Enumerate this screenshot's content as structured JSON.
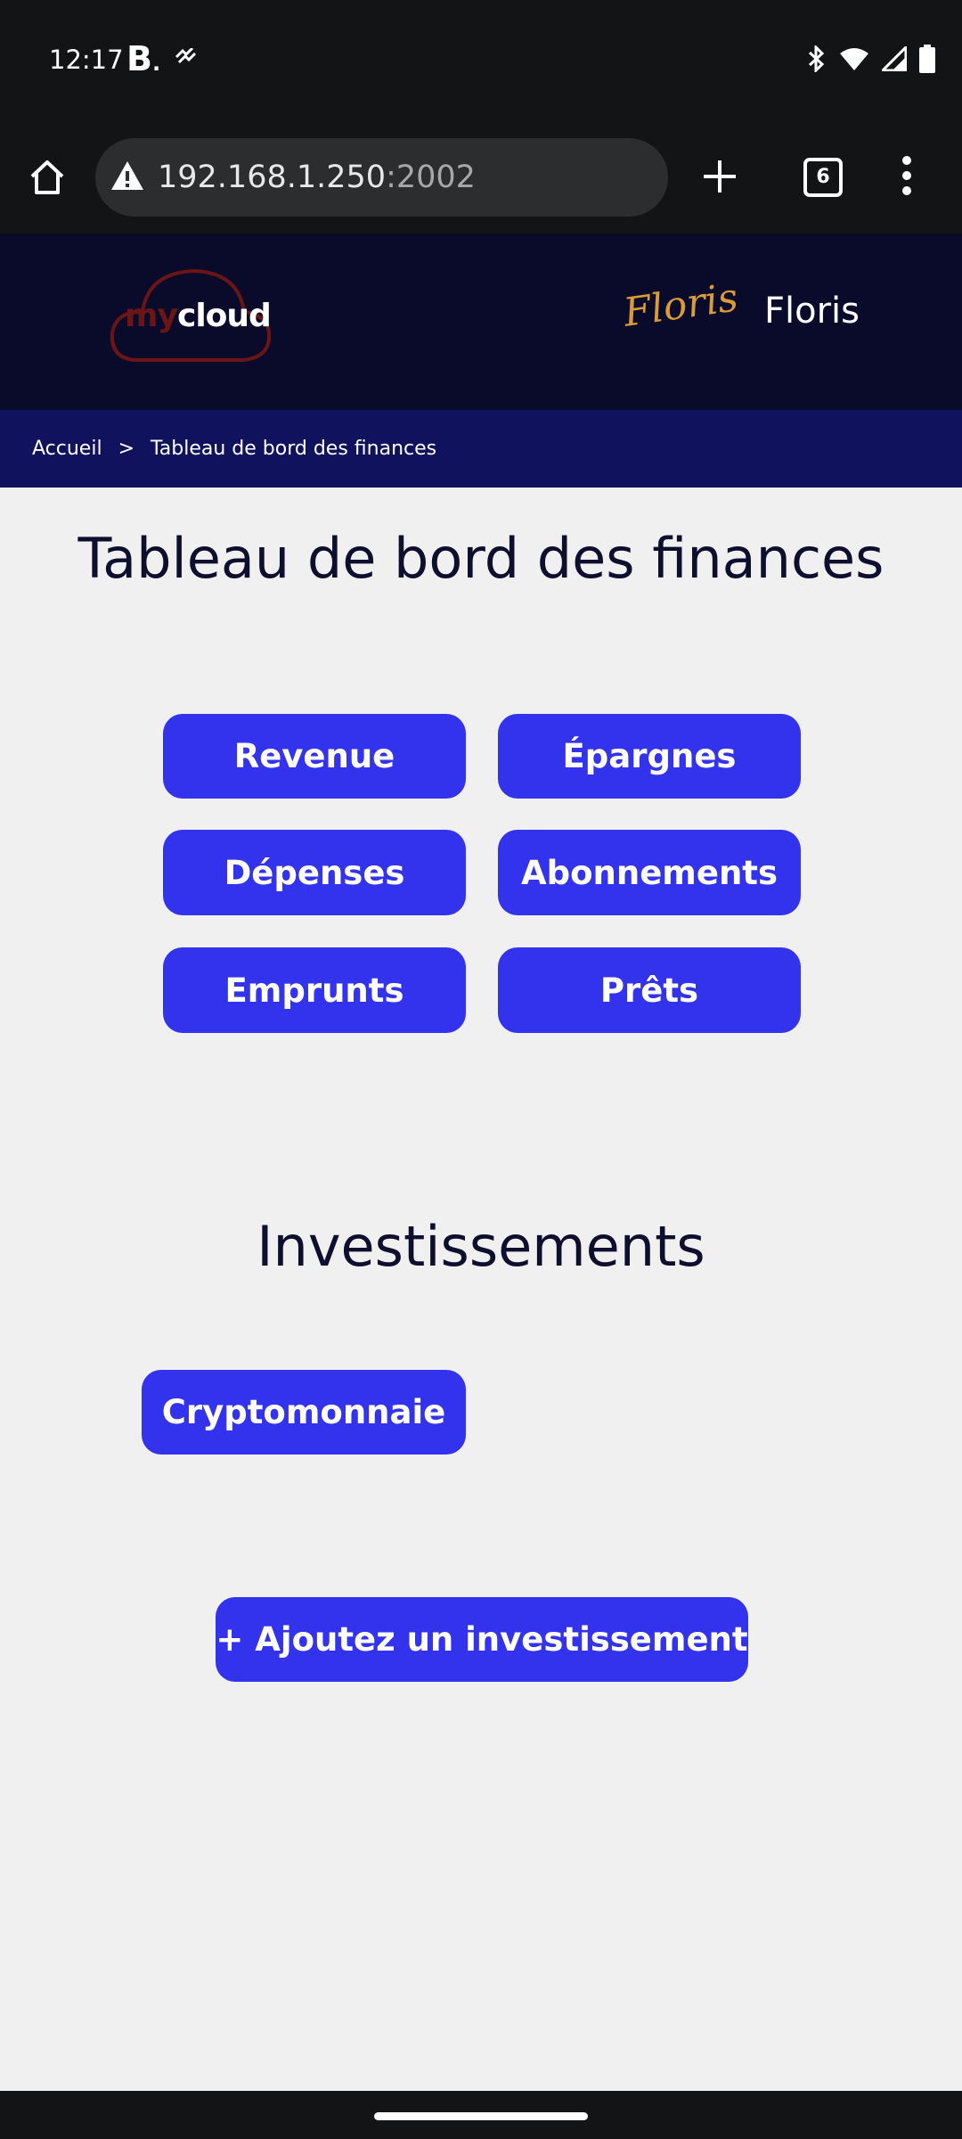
{
  "status": {
    "time": "12:17",
    "b_letter": "B",
    "b_dot": "."
  },
  "browser": {
    "url_host": "192.168.1.250",
    "url_port": ":2002",
    "tab_count": "6"
  },
  "header": {
    "logo_my": "my",
    "logo_cloud": "cloud",
    "user_logo_text": "Floris",
    "user_name": "Floris"
  },
  "breadcrumb": {
    "home": "Accueil",
    "separator": ">",
    "current": "Tableau de bord des finances"
  },
  "main": {
    "title": "Tableau de bord des finances",
    "buttons": {
      "revenue": "Revenue",
      "savings": "Épargnes",
      "expenses": "Dépenses",
      "subscriptions": "Abonnements",
      "borrowings": "Emprunts",
      "loans": "Prêts"
    }
  },
  "investments": {
    "title": "Investissements",
    "crypto": "Cryptomonnaie",
    "add": "+ Ajoutez un investissement"
  },
  "colors": {
    "accent": "#3333ee",
    "header_bg": "#0a0a2a",
    "breadcrumb_bg": "#11125e",
    "page_bg": "#f0f0f0"
  }
}
